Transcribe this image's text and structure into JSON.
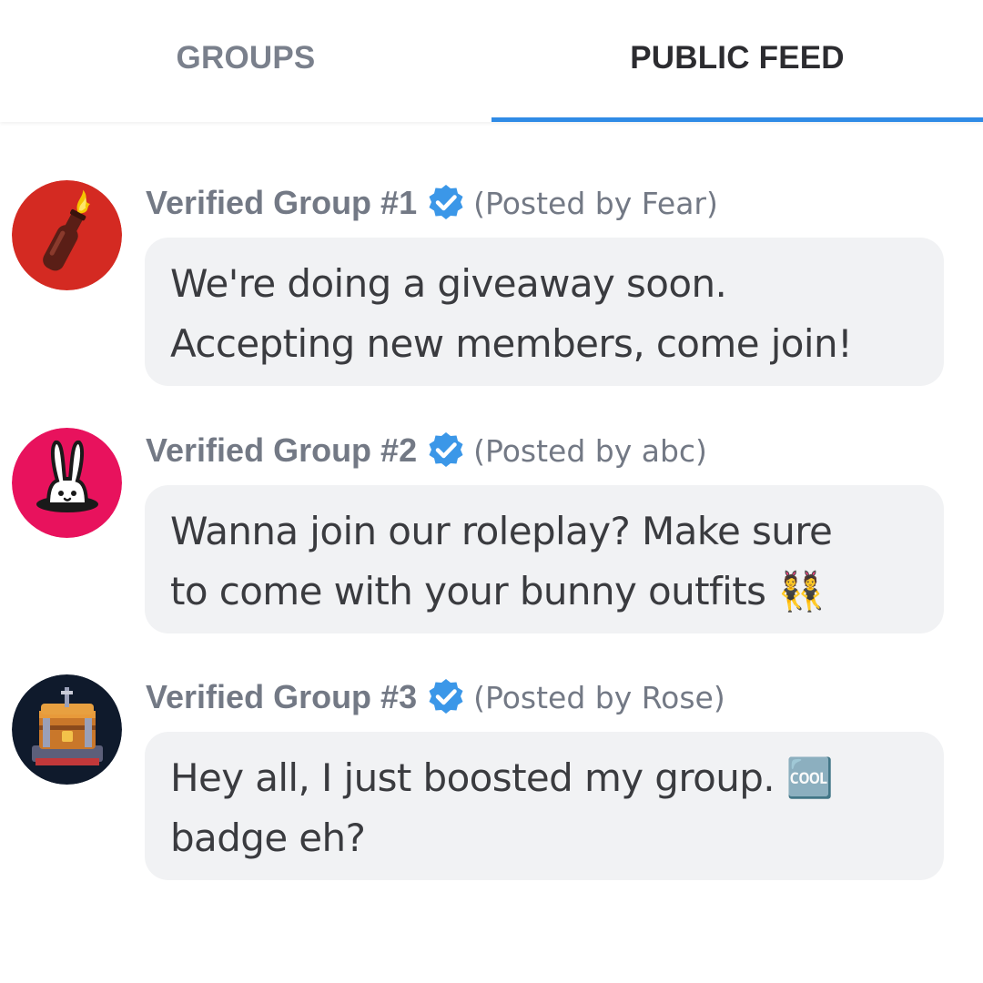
{
  "tabs": {
    "groups_label": "GROUPS",
    "public_feed_label": "PUBLIC FEED",
    "active": "public_feed"
  },
  "colors": {
    "accent": "#2f8be6",
    "verified_badge": "#3b97e8",
    "bubble_bg": "#f1f2f4",
    "muted_text": "#737985"
  },
  "posts": [
    {
      "group_name": "Verified Group #1",
      "posted_by": "(Posted by Fear)",
      "message": "We're doing a giveaway soon.\nAccepting new members, come join!",
      "avatar_icon": "molotov-cocktail-icon",
      "avatar_bg": "#d42a22"
    },
    {
      "group_name": "Verified Group #2",
      "posted_by": "(Posted by abc)",
      "message": "Wanna join our roleplay? Make sure\nto come with your bunny outfits 👯",
      "avatar_icon": "bunny-in-hole-icon",
      "avatar_bg": "#e8125d"
    },
    {
      "group_name": "Verified Group #3",
      "posted_by": "(Posted by Rose)",
      "message": "Hey all, I just boosted my group. 🆒\nbadge eh?",
      "avatar_icon": "treasure-chest-icon",
      "avatar_bg": "#0f1a2c"
    }
  ]
}
